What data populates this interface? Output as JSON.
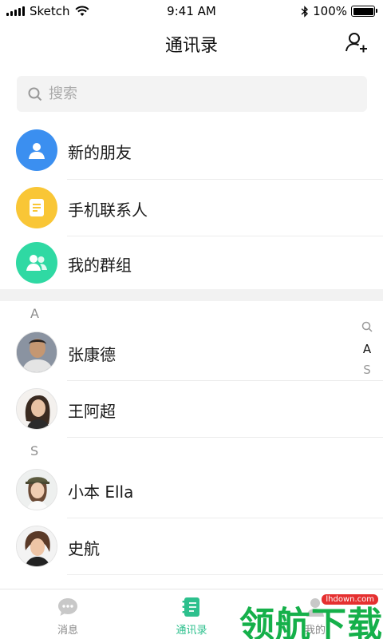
{
  "status_bar": {
    "carrier": "Sketch",
    "time": "9:41 AM",
    "battery": "100%"
  },
  "nav": {
    "title": "通讯录"
  },
  "search": {
    "placeholder": "搜索"
  },
  "menu": [
    {
      "label": "新的朋友",
      "icon": "person-icon",
      "color": "#3b8ff0"
    },
    {
      "label": "手机联系人",
      "icon": "document-icon",
      "color": "#f9c636"
    },
    {
      "label": "我的群组",
      "icon": "group-icon",
      "color": "#2fd9a3"
    }
  ],
  "sections": [
    {
      "letter": "A",
      "contacts": [
        {
          "name": "张康德",
          "avatar": "avatar-male-icon"
        },
        {
          "name": "王阿超",
          "avatar": "avatar-female-icon"
        }
      ]
    },
    {
      "letter": "S",
      "contacts": [
        {
          "name": "小本 Ella",
          "avatar": "avatar-female-icon"
        },
        {
          "name": "史航",
          "avatar": "avatar-female-icon"
        }
      ]
    }
  ],
  "index_bar": [
    "A",
    "S"
  ],
  "tabs": [
    {
      "label": "消息",
      "icon": "chat-icon"
    },
    {
      "label": "通讯录",
      "icon": "contacts-book-icon"
    },
    {
      "label": "我的",
      "icon": "profile-icon"
    }
  ],
  "watermark": {
    "text": "领航下载",
    "url": "lhdown.com"
  },
  "colors": {
    "accent": "#2dc08d",
    "watermark": "#15b04a"
  }
}
